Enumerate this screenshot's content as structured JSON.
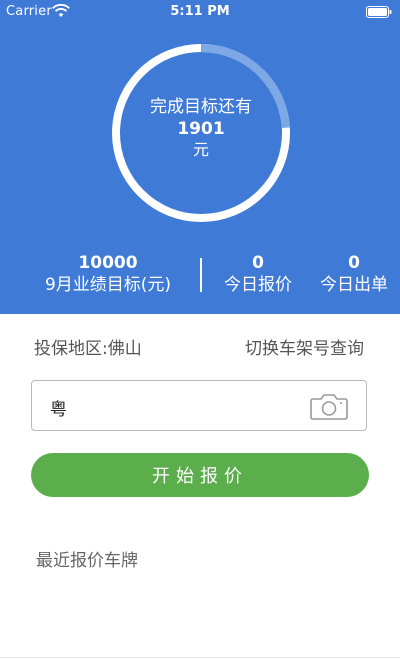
{
  "status_bar": {
    "carrier": "Carrier",
    "time": "5:11 PM",
    "wifi_icon": "wifi-icon",
    "battery_icon": "battery-icon"
  },
  "goal": {
    "caption": "完成目标还有",
    "remaining": "1901",
    "unit": "元",
    "progress_fraction": 0.24
  },
  "stats": {
    "target_value": "10000",
    "target_label": "9月业绩目标(元)",
    "quotes_value": "0",
    "quotes_label": "今日报价",
    "orders_value": "0",
    "orders_label": "今日出单"
  },
  "region": {
    "label": "投保地区:佛山",
    "vin_link": "切换车架号查询"
  },
  "plate": {
    "prefix": "粤",
    "value": "",
    "camera_icon": "camera-icon"
  },
  "actions": {
    "start_quote": "开始报价"
  },
  "recent": {
    "title": "最近报价车牌"
  },
  "colors": {
    "header_blue": "#3f7bd6",
    "ring_track": "#ffffff",
    "ring_progress": "#7ea7e6",
    "button_green": "#5cae4c"
  }
}
